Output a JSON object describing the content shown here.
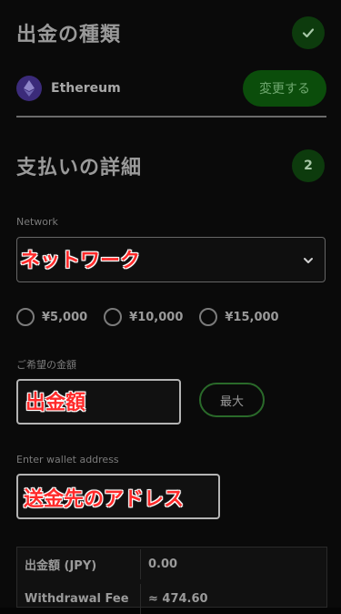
{
  "withdrawal_type": {
    "title": "出金の種類",
    "coin_name": "Ethereum",
    "change_label": "変更する"
  },
  "payment_details": {
    "title": "支払いの詳細",
    "step_number": "2"
  },
  "network": {
    "label": "Network",
    "overlay_label": "ネットワーク"
  },
  "quick_amounts": [
    {
      "label": "¥5,000"
    },
    {
      "label": "¥10,000"
    },
    {
      "label": "¥15,000"
    }
  ],
  "amount": {
    "label": "ご希望の金額",
    "overlay_label": "出金額",
    "max_label": "最大"
  },
  "wallet": {
    "label": "Enter wallet address",
    "overlay_label": "送金先のアドレス"
  },
  "summary": {
    "rows": [
      {
        "key": "出金額 (JPY)",
        "value": "0.00"
      },
      {
        "key": "Withdrawal Fee",
        "value": "≈ 474.60"
      }
    ]
  },
  "colors": {
    "accent_green": "#0b4d0b",
    "overlay_red": "#ff2a2a"
  }
}
